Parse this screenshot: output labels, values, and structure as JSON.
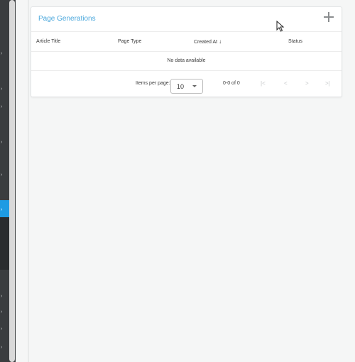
{
  "card": {
    "title": "Page Generations",
    "add_icon": "plus-icon"
  },
  "table": {
    "columns": [
      {
        "label": "Article Title"
      },
      {
        "label": "Page Type"
      },
      {
        "label": "Created At",
        "sort": "descending",
        "sort_icon": "arrow-down-icon"
      },
      {
        "label": "Status"
      }
    ],
    "empty_message": "No data available"
  },
  "paginator": {
    "items_per_page_label": "Items per page:",
    "items_per_page_value": "10",
    "range_label": "0-0 of 0",
    "icons": [
      "first-page-icon",
      "previous-page-icon",
      "next-page-icon",
      "last-page-icon"
    ],
    "first": "|<",
    "prev": "<",
    "next": ">",
    "last": ">|"
  },
  "colors": {
    "title_accent": "#4aa7dc",
    "sidebar_active": "#1e9be3",
    "sidebar_bg": "#3a3d3f"
  }
}
